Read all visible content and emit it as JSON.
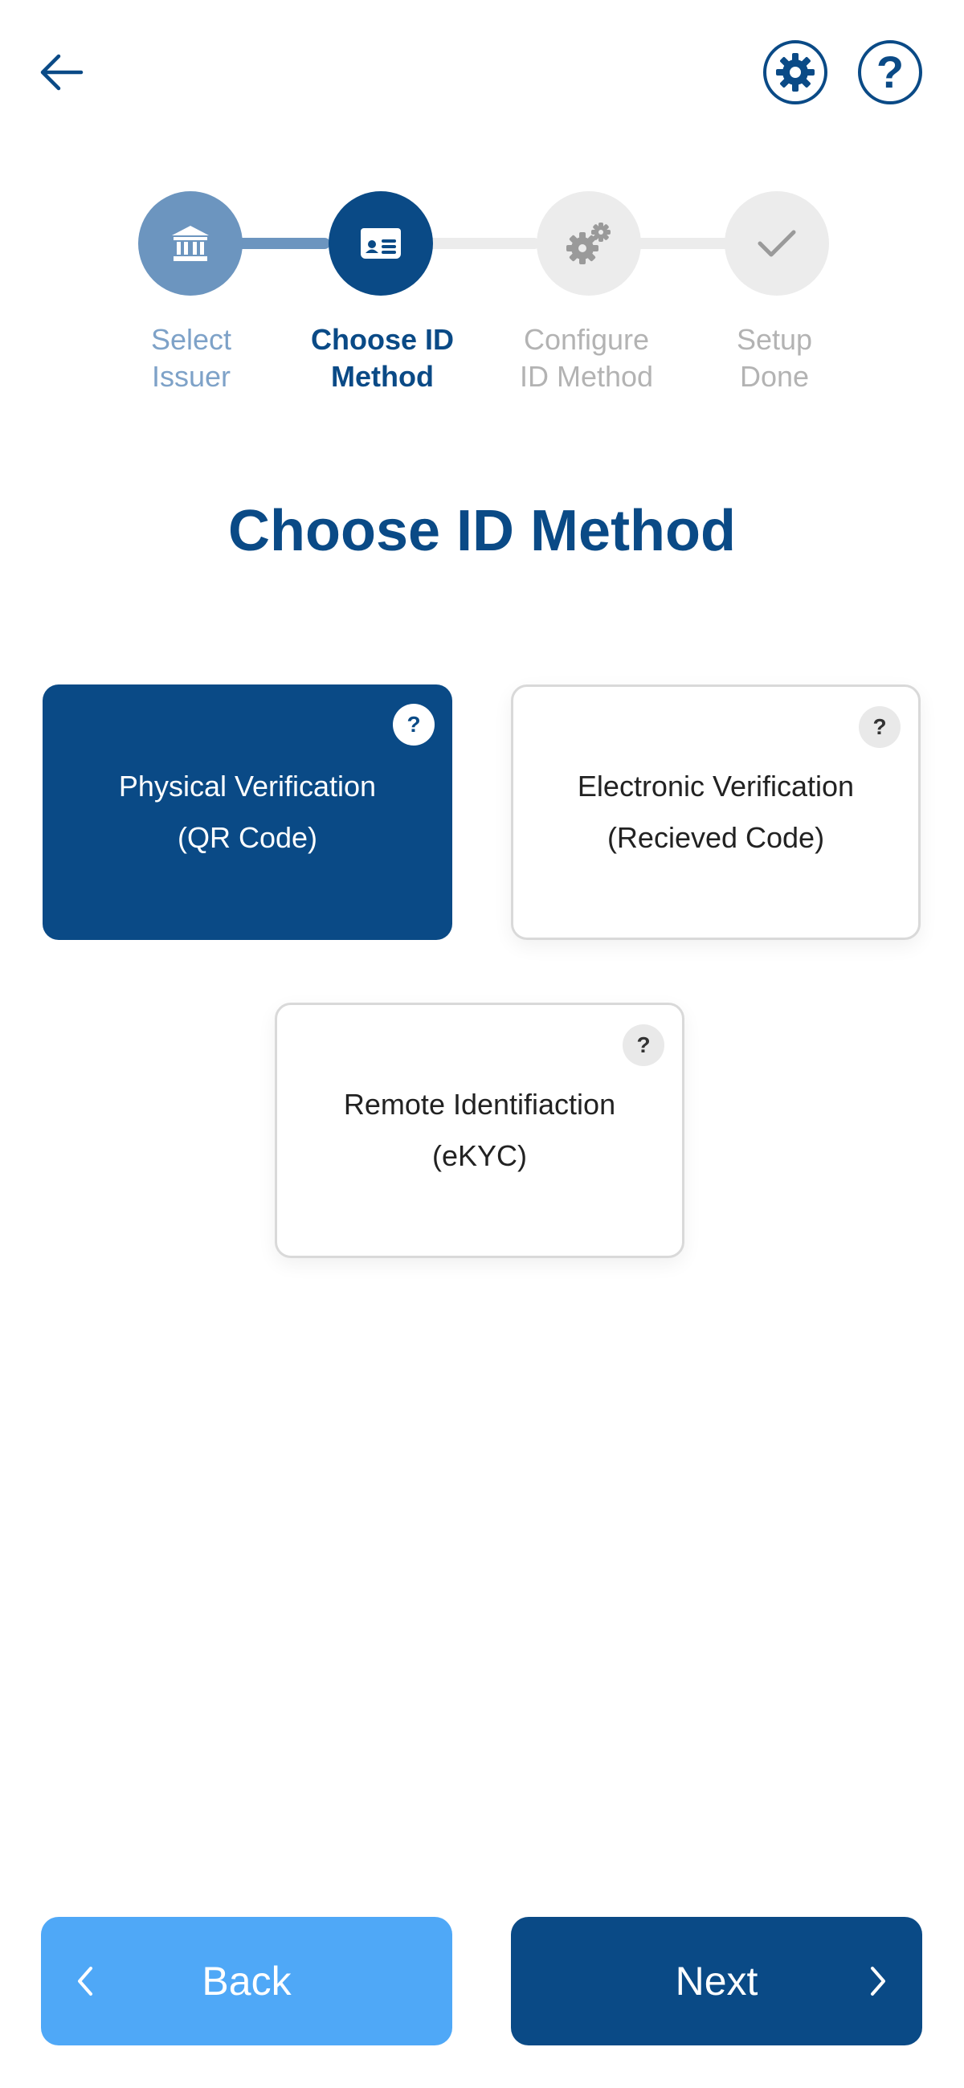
{
  "header": {
    "back_icon": "arrow-left-icon",
    "settings_icon": "gear-icon",
    "help_label": "?"
  },
  "stepper": {
    "steps": [
      {
        "label": "Select\nIssuer",
        "icon": "bank-icon",
        "state": "completed"
      },
      {
        "label": "Choose ID\nMethod",
        "icon": "id-card-icon",
        "state": "active"
      },
      {
        "label": "Configure\nID Method",
        "icon": "gears-icon",
        "state": "pending"
      },
      {
        "label": "Setup\nDone",
        "icon": "check-icon",
        "state": "pending"
      }
    ]
  },
  "page": {
    "title": "Choose ID Method"
  },
  "options": [
    {
      "line1": "Physical Verification",
      "line2": "(QR Code)",
      "help": "?",
      "selected": true
    },
    {
      "line1": "Electronic Verification",
      "line2": "(Recieved Code)",
      "help": "?",
      "selected": false
    },
    {
      "line1": "Remote Identifiaction",
      "line2": "(eKYC)",
      "help": "?",
      "selected": false
    }
  ],
  "footer": {
    "back_label": "Back",
    "next_label": "Next"
  },
  "colors": {
    "primary": "#0a4a86",
    "completed": "#6c95bf",
    "back_button": "#4fa8f7",
    "pending": "#ececec"
  }
}
